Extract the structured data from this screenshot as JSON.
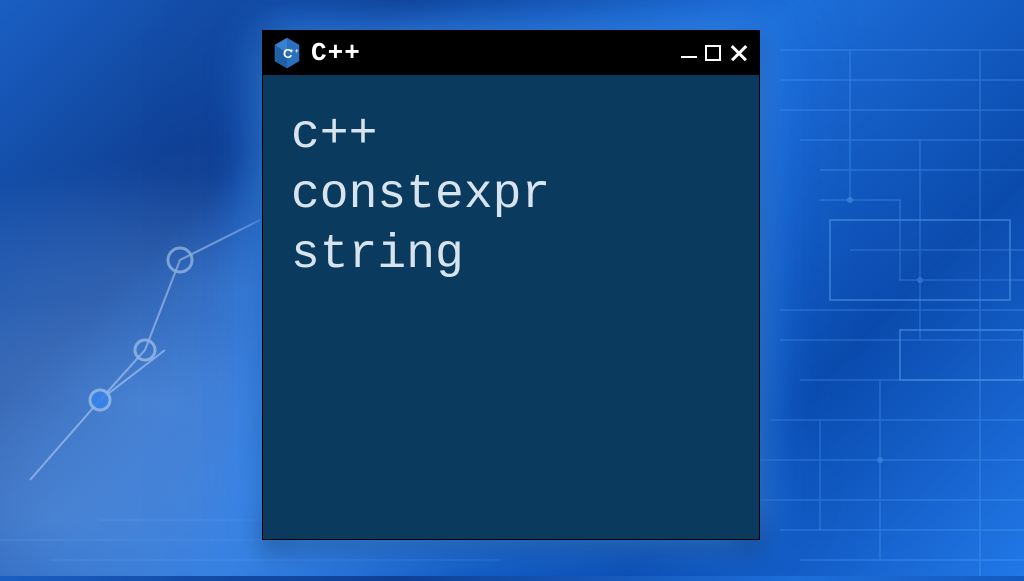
{
  "window": {
    "title": "C++",
    "icon": "cpp-icon"
  },
  "content": {
    "line1": "c++",
    "line2": "constexpr",
    "line3": "string"
  }
}
